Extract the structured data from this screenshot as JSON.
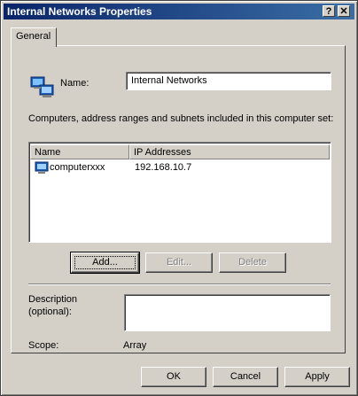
{
  "window": {
    "title": "Internal Networks Properties",
    "help_glyph": "?",
    "close_glyph": "✕"
  },
  "tabs": [
    {
      "label": "General"
    }
  ],
  "name": {
    "label": "Name:",
    "value": "Internal Networks"
  },
  "computers": {
    "description": "Computers, address ranges and subnets included in this computer set:",
    "columns": [
      "Name",
      "IP Addresses"
    ],
    "rows": [
      {
        "name": "computerxxx",
        "ip": "192.168.10.7"
      }
    ]
  },
  "actions": {
    "add": "Add...",
    "edit": "Edit...",
    "delete": "Delete"
  },
  "description_field": {
    "label_line1": "Description",
    "label_line2": "(optional):",
    "value": ""
  },
  "scope": {
    "label": "Scope:",
    "value": "Array"
  },
  "footer": {
    "ok": "OK",
    "cancel": "Cancel",
    "apply": "Apply"
  },
  "icons": {
    "network": "network-computers-icon",
    "computer": "computer-icon"
  },
  "colors": {
    "titlebar_start": "#0a246a",
    "titlebar_end": "#3a6ea5",
    "face": "#d4d0c8"
  }
}
